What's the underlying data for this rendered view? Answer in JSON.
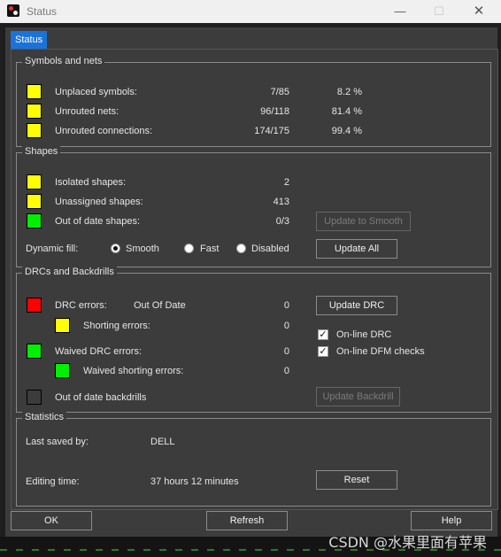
{
  "window": {
    "title": "Status",
    "min_glyph": "—",
    "max_glyph": "☐",
    "close_glyph": "✕"
  },
  "tab": {
    "label": "Status"
  },
  "symbols_nets": {
    "title": "Symbols and nets",
    "rows": [
      {
        "label": "Unplaced symbols:",
        "count": "7/85",
        "pct": "8.2 %",
        "color": "#ffff00"
      },
      {
        "label": "Unrouted nets:",
        "count": "96/118",
        "pct": "81.4 %",
        "color": "#ffff00"
      },
      {
        "label": "Unrouted connections:",
        "count": "174/175",
        "pct": "99.4 %",
        "color": "#ffff00"
      }
    ]
  },
  "shapes": {
    "title": "Shapes",
    "rows": [
      {
        "label": "Isolated shapes:",
        "count": "2",
        "color": "#ffff00"
      },
      {
        "label": "Unassigned shapes:",
        "count": "413",
        "color": "#ffff00"
      },
      {
        "label": "Out of date shapes:",
        "count": "0/3",
        "color": "#00ee00"
      }
    ],
    "update_smooth": "Update to Smooth",
    "dynamic_fill_label": "Dynamic fill:",
    "fill_options": [
      "Smooth",
      "Fast",
      "Disabled"
    ],
    "fill_selected": "Smooth",
    "update_all": "Update All"
  },
  "drc": {
    "title": "DRCs and Backdrills",
    "drc_errors_label": "DRC errors:",
    "drc_status": "Out Of Date",
    "drc_errors_count": "0",
    "drc_color": "#ff0000",
    "shorting_label": "Shorting errors:",
    "shorting_count": "0",
    "shorting_color": "#ffff00",
    "waived_label": "Waived DRC errors:",
    "waived_count": "0",
    "waived_color": "#00ee00",
    "waived_shorting_label": "Waived shorting errors:",
    "waived_shorting_count": "0",
    "waived_shorting_color": "#00ee00",
    "backdrills_label": "Out of date backdrills",
    "backdrills_color": "#3c3c3c",
    "update_drc": "Update DRC",
    "online_drc": "On-line DRC",
    "online_dfm": "On-line DFM checks",
    "update_backdrill": "Update Backdrill"
  },
  "statistics": {
    "title": "Statistics",
    "last_saved_label": "Last saved by:",
    "last_saved_value": "DELL",
    "editing_label": "Editing time:",
    "editing_value": "37 hours 12 minutes",
    "reset": "Reset"
  },
  "buttons": {
    "ok": "OK",
    "refresh": "Refresh",
    "help": "Help"
  },
  "watermark": "CSDN @水果里面有苹果"
}
